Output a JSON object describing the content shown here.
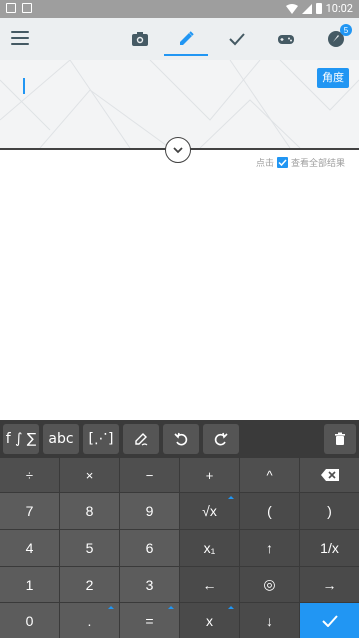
{
  "status_bar": {
    "time": "10:02"
  },
  "toolbar": {
    "tabs": [
      {
        "name": "camera",
        "icon": "camera-icon"
      },
      {
        "name": "edit",
        "icon": "pencil-icon",
        "active": true
      },
      {
        "name": "check",
        "icon": "check-icon"
      },
      {
        "name": "game",
        "icon": "gamepad-icon"
      },
      {
        "name": "rocket",
        "icon": "rocket-icon",
        "badge": "5"
      }
    ]
  },
  "input": {
    "angle_label": "角度",
    "value": ""
  },
  "show_all": {
    "prefix": "点击",
    "suffix": "查看全部结果"
  },
  "keyboard": {
    "toolbar": {
      "functions_label": "f ∫ ∑",
      "letters_label": "abc",
      "matrix_label": "[⋰]"
    },
    "rows": [
      [
        "÷",
        "×",
        "−",
        "+",
        "^",
        "⌫"
      ],
      [
        "7",
        "8",
        "9",
        "√x",
        "(",
        ")"
      ],
      [
        "4",
        "5",
        "6",
        "x₁",
        "↑",
        "1/x"
      ],
      [
        "1",
        "2",
        "3",
        "←",
        "◎",
        "→"
      ],
      [
        "0",
        ".",
        "=",
        "x",
        "↓",
        "✓"
      ]
    ]
  },
  "colors": {
    "accent": "#2196f3",
    "keyboard_bg": "#3a3a3a",
    "key_light": "#5c5c5c",
    "key_dark": "#4a4a4a"
  }
}
